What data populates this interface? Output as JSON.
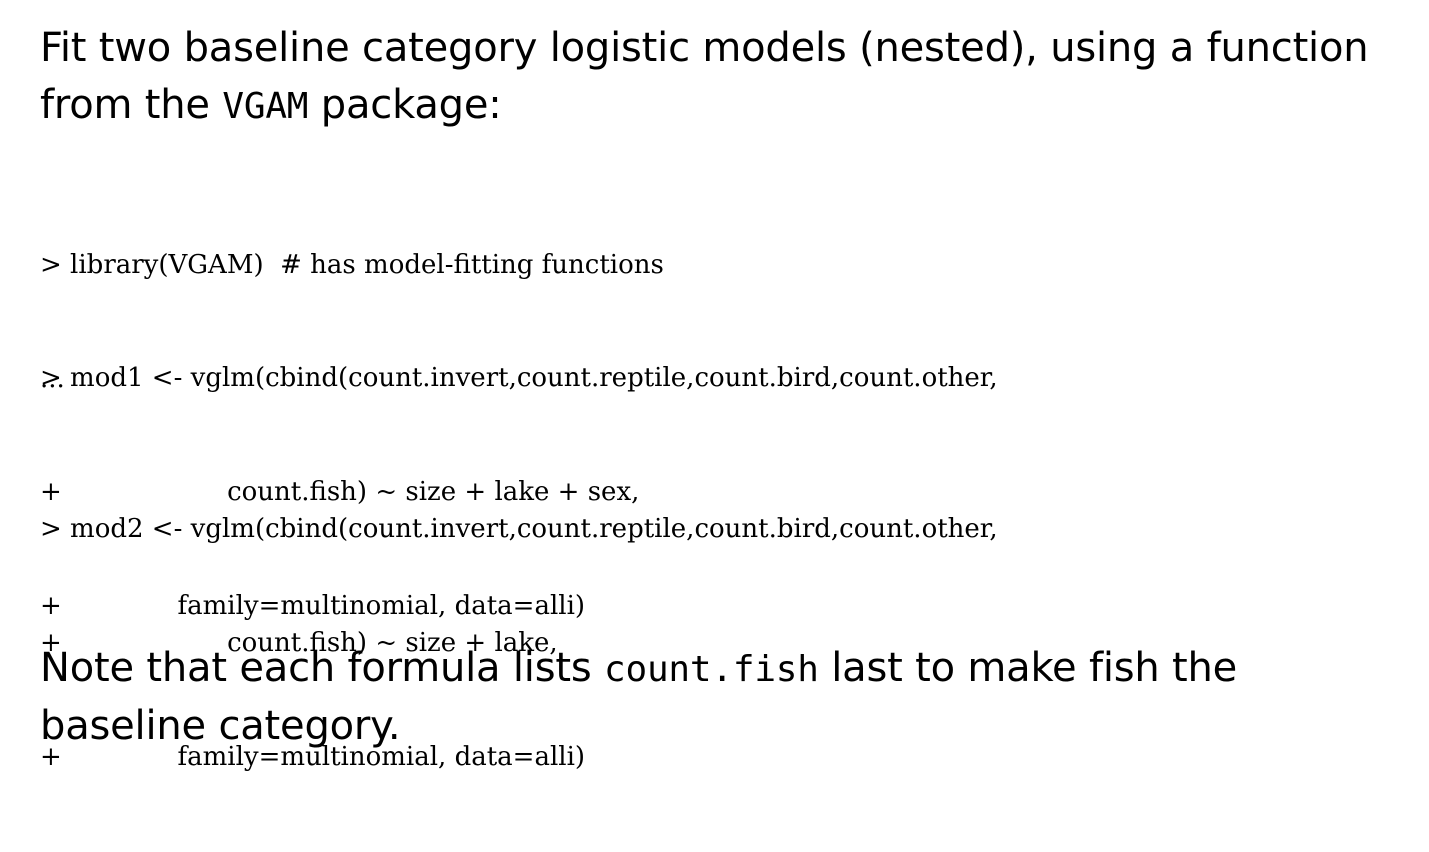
{
  "intro": {
    "line1": "Fit two baseline category logistic models (nested), using a function",
    "line2_before": "from the ",
    "line2_code": "VGAM",
    "line2_after": " package:"
  },
  "code": {
    "library_block": [
      "> library(VGAM)  # has model-fitting functions",
      "..."
    ],
    "mod1_block": [
      "> mod1 <- vglm(cbind(count.invert,count.reptile,count.bird,count.other,",
      "+                    count.fish) ~ size + lake + sex,",
      "+              family=multinomial, data=alli)"
    ],
    "mod2_block": [
      "> mod2 <- vglm(cbind(count.invert,count.reptile,count.bird,count.other,",
      "+                    count.fish) ~ size + lake,",
      "+              family=multinomial, data=alli)"
    ]
  },
  "note": {
    "line1_before": "Note that each formula lists ",
    "line1_code": "count.fish",
    "line1_after": " last to make fish the",
    "line2": "baseline category."
  }
}
